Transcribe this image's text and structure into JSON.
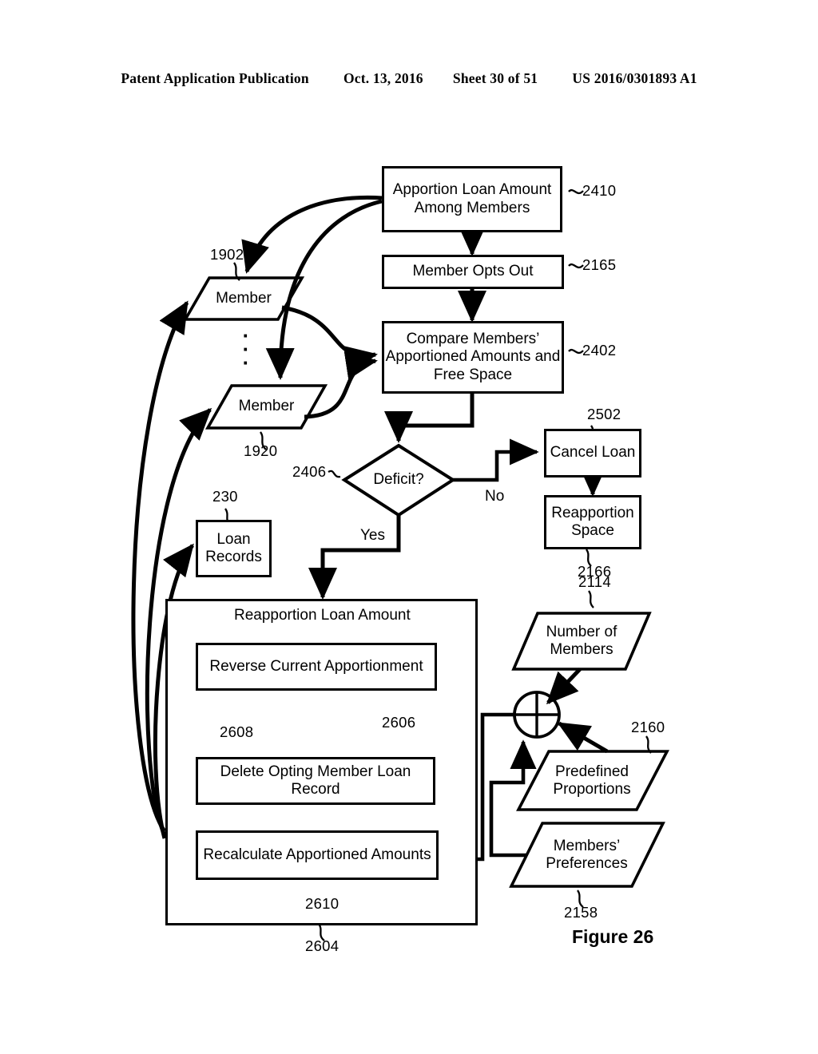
{
  "header": {
    "publication": "Patent Application Publication",
    "date": "Oct. 13, 2016",
    "sheet": "Sheet 30 of 51",
    "number": "US 2016/0301893 A1"
  },
  "figure": {
    "caption": "Figure 26"
  },
  "nodes": {
    "apportion_loan": {
      "label": "Apportion Loan Amount Among Members",
      "ref": "2410",
      "shape": "process"
    },
    "member_opts_out": {
      "label": "Member Opts Out",
      "ref": "2165",
      "shape": "process"
    },
    "compare_members": {
      "label": "Compare Members’ Apportioned Amounts and Free Space",
      "ref": "2402",
      "shape": "process"
    },
    "member_first": {
      "label": "Member",
      "ref": "1902",
      "shape": "data"
    },
    "member_last": {
      "label": "Member",
      "ref": "1920",
      "shape": "data"
    },
    "deficit": {
      "label": "Deficit?",
      "ref": "2406",
      "shape": "decision"
    },
    "cancel_loan": {
      "label": "Cancel Loan",
      "ref": "2502",
      "shape": "process"
    },
    "reapportion_space": {
      "label": "Reapportion Space",
      "ref": "2166",
      "shape": "process"
    },
    "loan_records": {
      "label": "Loan Records",
      "ref": "230",
      "shape": "process"
    },
    "reapportion_loan_amount": {
      "label": "Reapportion Loan Amount",
      "ref": "2604",
      "shape": "container"
    },
    "reverse_apportionment": {
      "label": "Reverse Current Apportionment",
      "ref": "2606",
      "shape": "process"
    },
    "delete_record": {
      "label": "Delete Opting Member Loan Record",
      "ref": "2608",
      "shape": "process"
    },
    "recalculate": {
      "label": "Recalculate Apportioned Amounts",
      "ref": "2610",
      "shape": "process"
    },
    "number_of_members": {
      "label": "Number of Members",
      "ref": "2114",
      "shape": "data"
    },
    "predefined_proportions": {
      "label": "Predefined Proportions",
      "ref": "2160",
      "shape": "data"
    },
    "members_preferences": {
      "label": "Members’ Preferences",
      "ref": "2158",
      "shape": "data"
    },
    "summing_junction": {
      "label": "",
      "ref": "",
      "shape": "circle-plus"
    }
  },
  "edge_labels": {
    "yes": "Yes",
    "no": "No"
  },
  "ellipsis": {
    "glyph": "·"
  },
  "colors": {
    "stroke": "#000000",
    "fill": "#ffffff"
  }
}
